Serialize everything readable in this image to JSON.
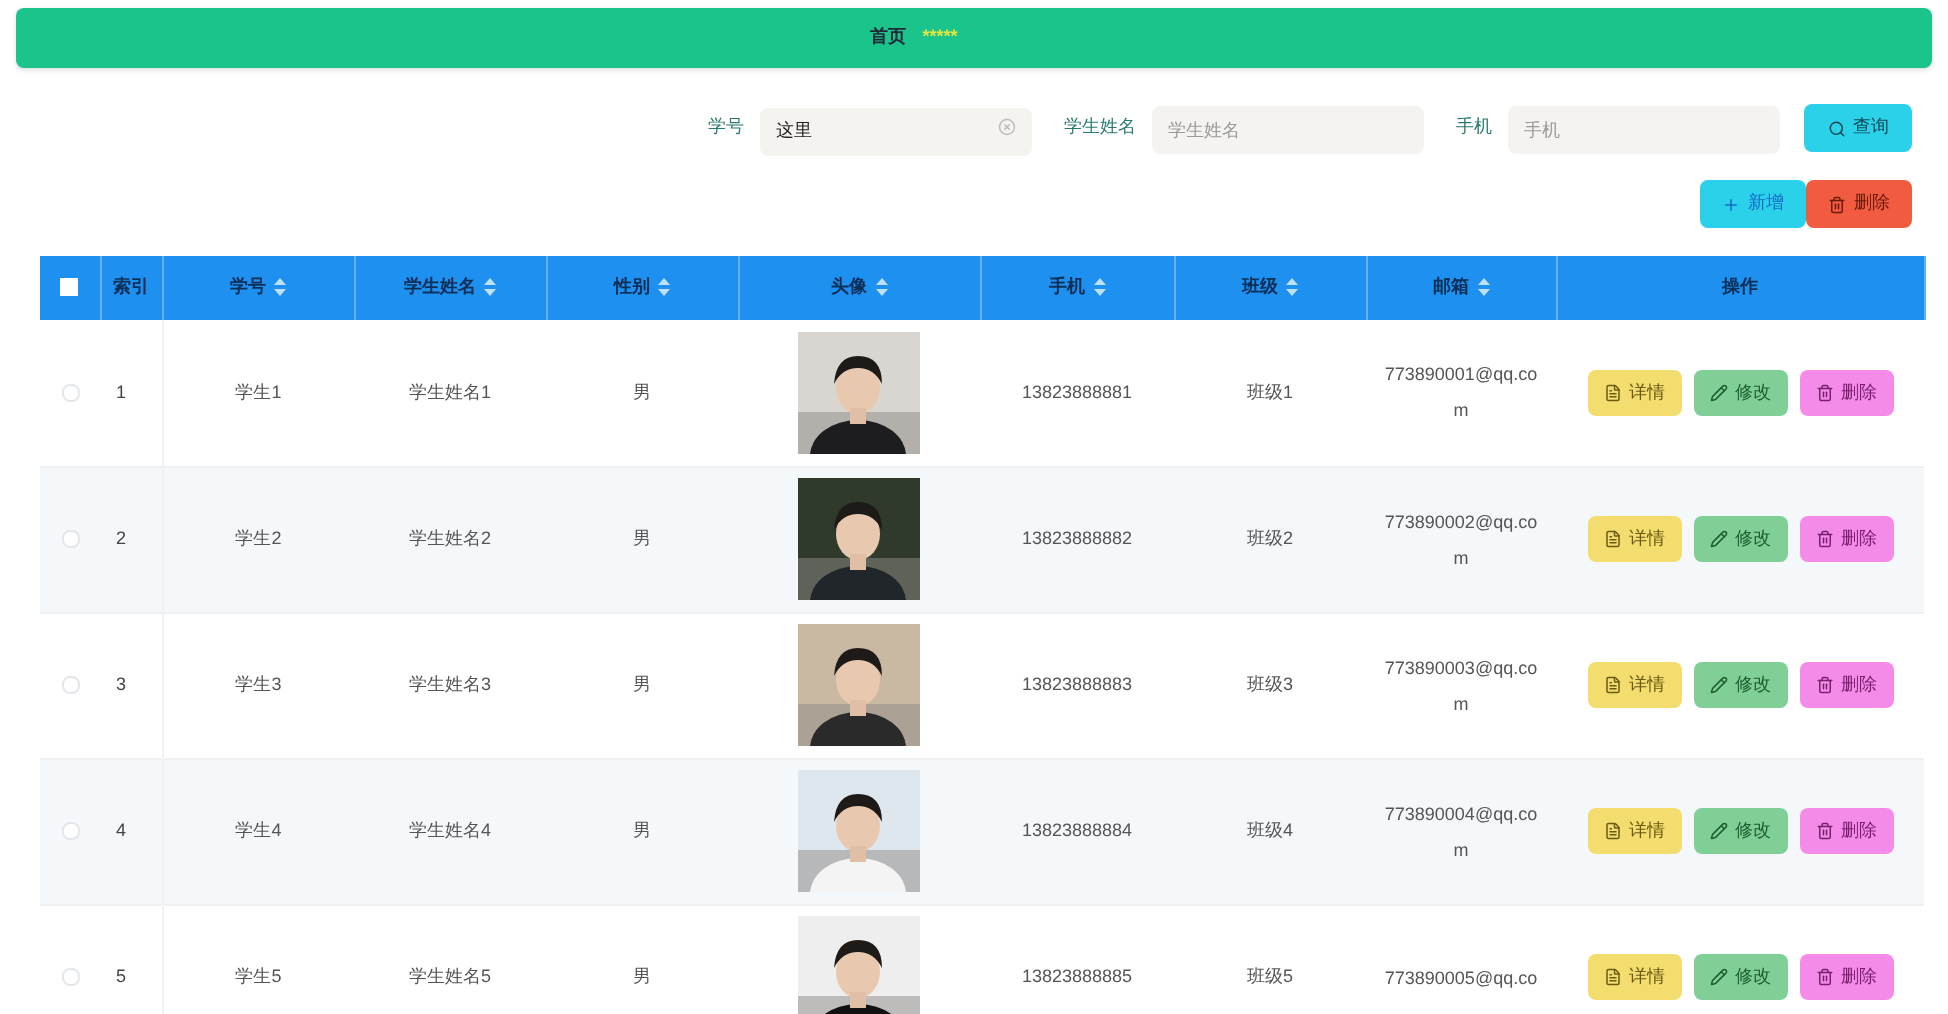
{
  "breadcrumb": [
    {
      "label": "首页",
      "color": "#1f2937"
    },
    {
      "label": "*****",
      "color": "#e5e542"
    }
  ],
  "search": {
    "fields": [
      {
        "label": "学号",
        "value": "这里"
      },
      {
        "label": "学生姓名",
        "placeholder": "学生姓名"
      },
      {
        "label": "手机",
        "placeholder": "手机"
      }
    ],
    "button": "查询"
  },
  "toolbar": [
    {
      "label": "新增",
      "kind": "add"
    },
    {
      "label": "删除",
      "kind": "delete"
    }
  ],
  "table": {
    "select_all": {
      "checked": false
    },
    "columns": [
      {
        "label": "索引",
        "sortable": false
      },
      {
        "label": "学号",
        "sortable": true
      },
      {
        "label": "学生姓名",
        "sortable": true
      },
      {
        "label": "性别",
        "sortable": true
      },
      {
        "label": "头像",
        "sortable": true
      },
      {
        "label": "手机",
        "sortable": true
      },
      {
        "label": "班级",
        "sortable": true
      },
      {
        "label": "邮箱",
        "sortable": true
      },
      {
        "label": "操作",
        "sortable": false
      }
    ],
    "rows": [
      {
        "selected": false,
        "index": "1",
        "student_id": "学生1",
        "name": "学生姓名1",
        "gender": "男",
        "phone": "13823888881",
        "class": "班级1",
        "email": "773890001@qq.com",
        "actions": [
          {
            "label": "详情",
            "kind": "detail"
          },
          {
            "label": "修改",
            "kind": "edit"
          },
          {
            "label": "删除",
            "kind": "delete"
          }
        ]
      },
      {
        "selected": false,
        "index": "2",
        "student_id": "学生2",
        "name": "学生姓名2",
        "gender": "男",
        "phone": "13823888882",
        "class": "班级2",
        "email": "773890002@qq.com",
        "actions": [
          {
            "label": "详情",
            "kind": "detail"
          },
          {
            "label": "修改",
            "kind": "edit"
          },
          {
            "label": "删除",
            "kind": "delete"
          }
        ]
      },
      {
        "selected": false,
        "index": "3",
        "student_id": "学生3",
        "name": "学生姓名3",
        "gender": "男",
        "phone": "13823888883",
        "class": "班级3",
        "email": "773890003@qq.com",
        "actions": [
          {
            "label": "详情",
            "kind": "detail"
          },
          {
            "label": "修改",
            "kind": "edit"
          },
          {
            "label": "删除",
            "kind": "delete"
          }
        ]
      },
      {
        "selected": false,
        "index": "4",
        "student_id": "学生4",
        "name": "学生姓名4",
        "gender": "男",
        "phone": "13823888884",
        "class": "班级4",
        "email": "773890004@qq.com",
        "actions": [
          {
            "label": "详情",
            "kind": "detail"
          },
          {
            "label": "修改",
            "kind": "edit"
          },
          {
            "label": "删除",
            "kind": "delete"
          }
        ]
      },
      {
        "selected": false,
        "index": "5",
        "student_id": "学生5",
        "name": "学生姓名5",
        "gender": "男",
        "phone": "13823888885",
        "class": "班级5",
        "email": "773890005@qq.co",
        "actions": [
          {
            "label": "详情",
            "kind": "detail"
          },
          {
            "label": "修改",
            "kind": "edit"
          },
          {
            "label": "删除",
            "kind": "delete"
          }
        ]
      }
    ]
  }
}
